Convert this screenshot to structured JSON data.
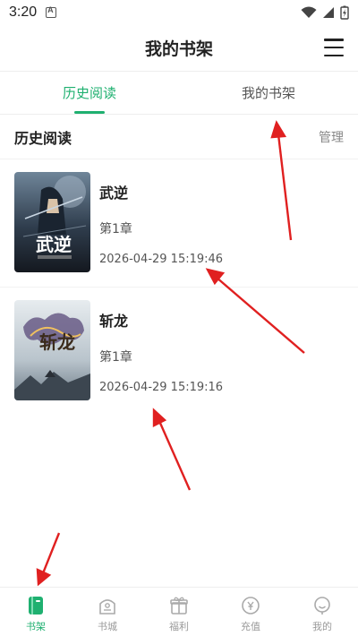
{
  "status_bar": {
    "time": "3:20"
  },
  "header": {
    "title": "我的书架",
    "menu_icon": "hamburger-menu-icon"
  },
  "tabs": [
    {
      "label": "历史阅读",
      "active": true
    },
    {
      "label": "我的书架",
      "active": false
    }
  ],
  "section": {
    "title": "历史阅读",
    "manage_label": "管理"
  },
  "books": [
    {
      "title": "武逆",
      "chapter": "第1章",
      "time": "2026-04-29  15:19:46",
      "cover_text": "武逆"
    },
    {
      "title": "斩龙",
      "chapter": "第1章",
      "time": "2026-04-29  15:19:16",
      "cover_text": "斩龙"
    }
  ],
  "bottom_nav": [
    {
      "label": "书架",
      "icon": "bookshelf-icon",
      "active": true
    },
    {
      "label": "书城",
      "icon": "bookstore-icon",
      "active": false
    },
    {
      "label": "福利",
      "icon": "gift-icon",
      "active": false
    },
    {
      "label": "充值",
      "icon": "recharge-icon",
      "active": false
    },
    {
      "label": "我的",
      "icon": "profile-icon",
      "active": false
    }
  ],
  "colors": {
    "accent": "#1fb070",
    "annotation": "#e02020"
  }
}
